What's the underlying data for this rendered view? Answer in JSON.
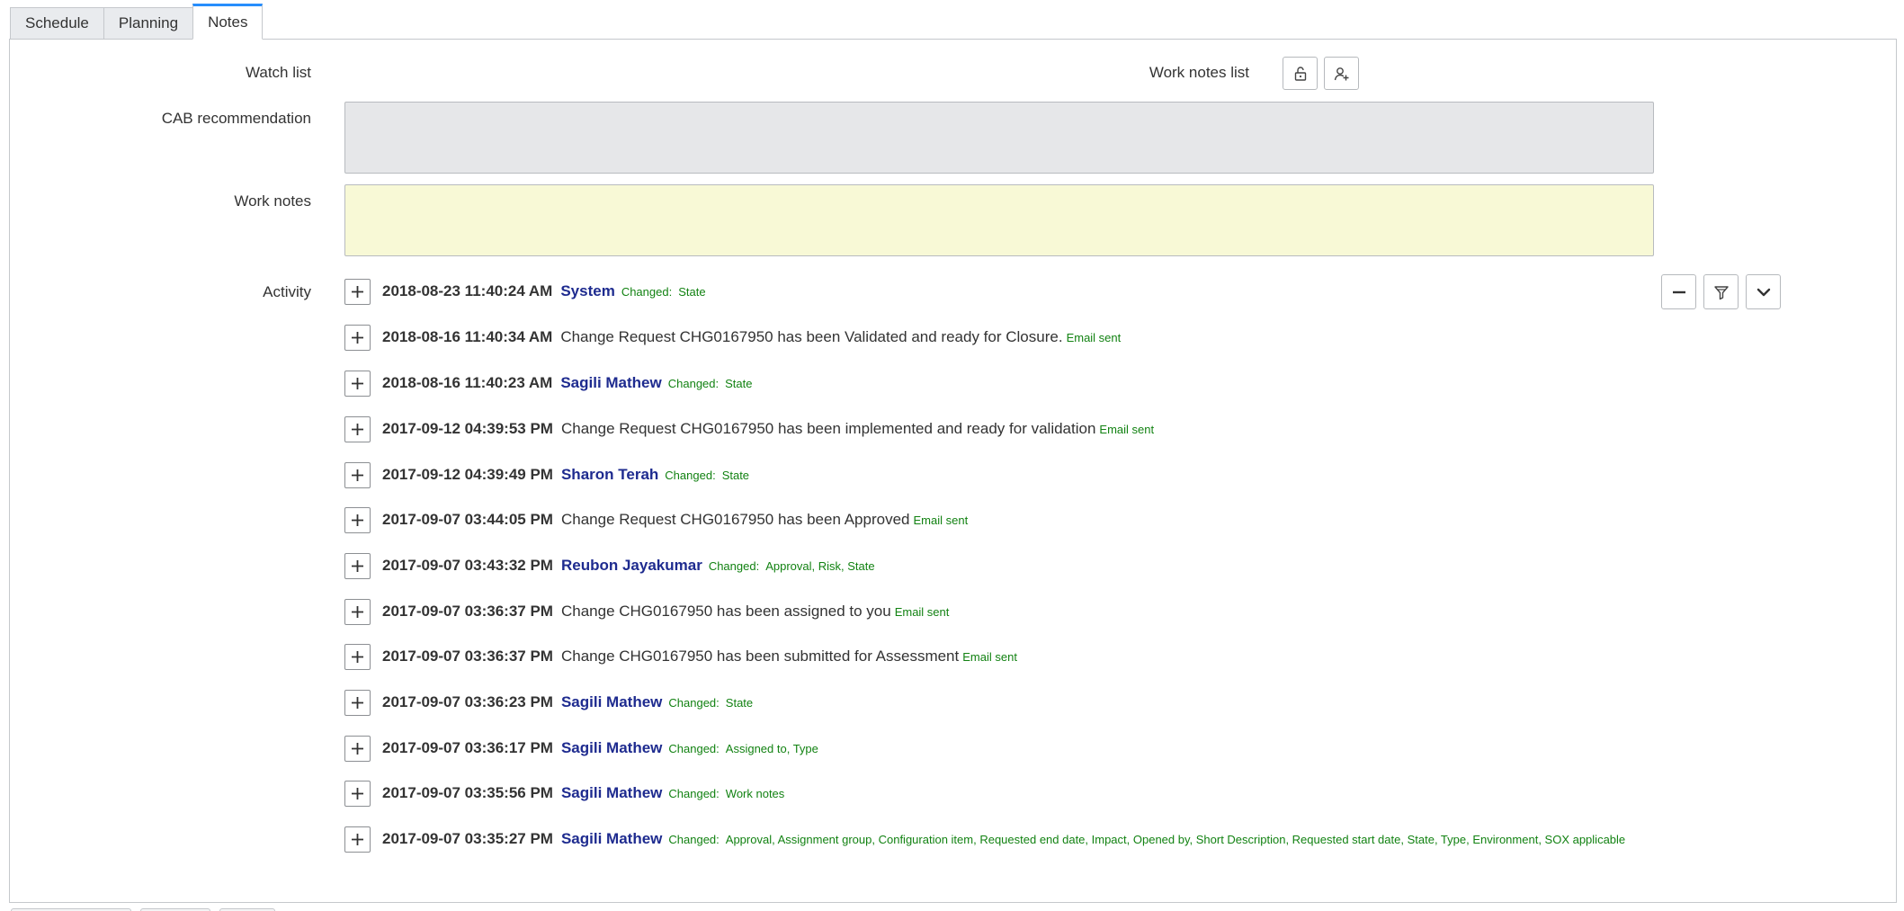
{
  "tabs": [
    {
      "label": "Schedule",
      "active": false
    },
    {
      "label": "Planning",
      "active": false
    },
    {
      "label": "Notes",
      "active": true
    }
  ],
  "form": {
    "watch_list_label": "Watch list",
    "work_notes_list_label": "Work notes list",
    "cab_recommendation_label": "CAB recommendation",
    "cab_recommendation_value": "",
    "work_notes_label": "Work notes",
    "work_notes_value": "",
    "activity_label": "Activity"
  },
  "icons": {
    "unlock": "unlock-icon",
    "add_user": "add-user-icon",
    "collapse": "minus-icon",
    "filter": "filter-icon",
    "more": "chevron-down-icon",
    "expand": "plus-icon"
  },
  "colors": {
    "author": "#1e2b8f",
    "change": "#128212",
    "active_tab": "#278efc",
    "cab_bg": "#e6e7e9",
    "work_notes_bg": "#f8f9d6"
  },
  "activity": [
    {
      "timestamp": "2018-08-23 11:40:24 AM",
      "author": "System",
      "changed_label": "Changed:",
      "changed_fields": "State"
    },
    {
      "timestamp": "2018-08-16 11:40:34 AM",
      "message": "Change Request CHG0167950 has been Validated and ready for Closure.",
      "email": "Email sent"
    },
    {
      "timestamp": "2018-08-16 11:40:23 AM",
      "author": "Sagili Mathew",
      "changed_label": "Changed:",
      "changed_fields": "State"
    },
    {
      "timestamp": "2017-09-12 04:39:53 PM",
      "message": "Change Request CHG0167950 has been implemented and ready for validation",
      "email": "Email sent"
    },
    {
      "timestamp": "2017-09-12 04:39:49 PM",
      "author": "Sharon Terah",
      "changed_label": "Changed:",
      "changed_fields": "State"
    },
    {
      "timestamp": "2017-09-07 03:44:05 PM",
      "message": "Change Request CHG0167950 has been Approved",
      "email": "Email sent"
    },
    {
      "timestamp": "2017-09-07 03:43:32 PM",
      "author": "Reubon Jayakumar",
      "changed_label": "Changed:",
      "changed_fields": "Approval, Risk, State"
    },
    {
      "timestamp": "2017-09-07 03:36:37 PM",
      "message": "Change CHG0167950 has been assigned to you",
      "email": "Email sent"
    },
    {
      "timestamp": "2017-09-07 03:36:37 PM",
      "message": "Change CHG0167950 has been submitted for Assessment",
      "email": "Email sent"
    },
    {
      "timestamp": "2017-09-07 03:36:23 PM",
      "author": "Sagili Mathew",
      "changed_label": "Changed:",
      "changed_fields": "State"
    },
    {
      "timestamp": "2017-09-07 03:36:17 PM",
      "author": "Sagili Mathew",
      "changed_label": "Changed:",
      "changed_fields": "Assigned to, Type"
    },
    {
      "timestamp": "2017-09-07 03:35:56 PM",
      "author": "Sagili Mathew",
      "changed_label": "Changed:",
      "changed_fields": "Work notes"
    },
    {
      "timestamp": "2017-09-07 03:35:27 PM",
      "author": "Sagili Mathew",
      "changed_label": "Changed:",
      "changed_fields": "Approval, Assignment group, Configuration item, Requested end date, Impact, Opened by, Short Description, Requested start date, State, Type, Environment, SOX applicable"
    }
  ]
}
